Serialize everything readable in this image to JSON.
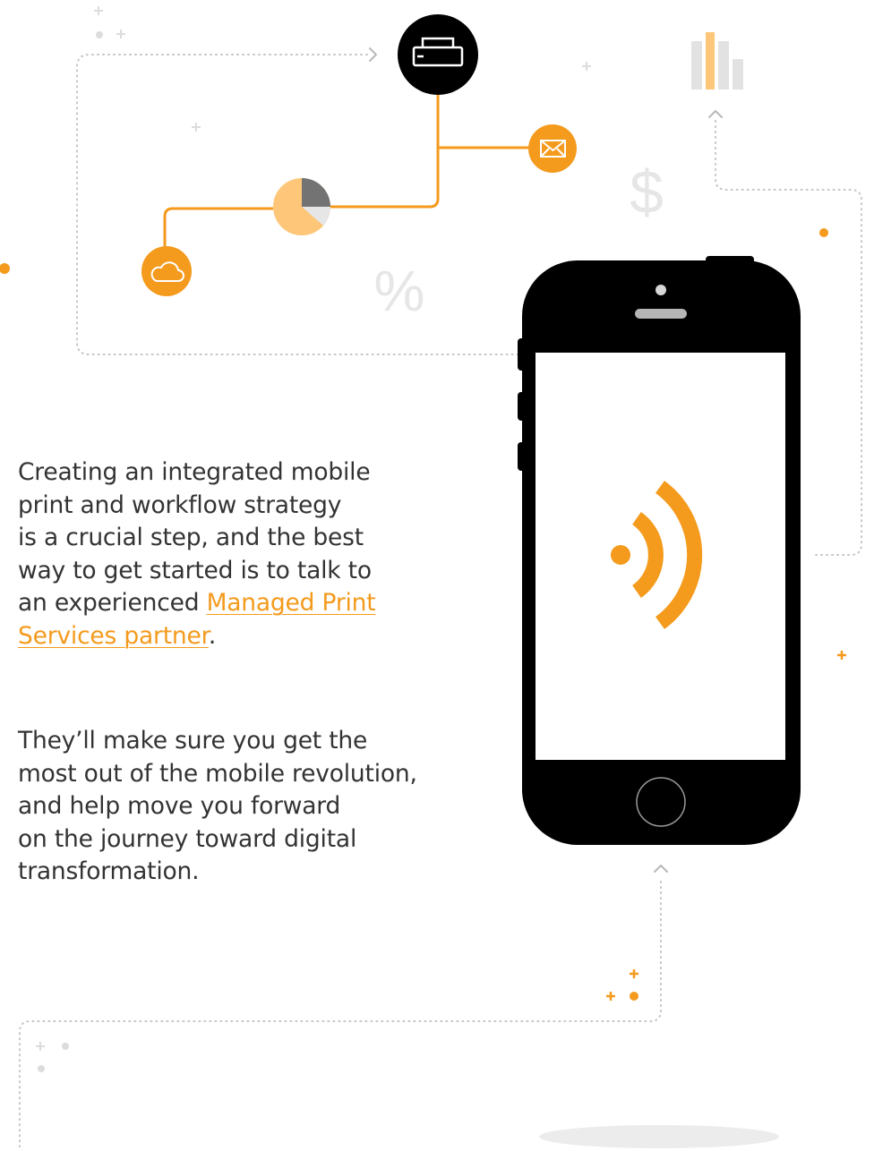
{
  "content": {
    "paragraph1": {
      "lines": [
        "Creating an integrated mobile",
        "print and workflow strategy",
        "is a crucial step, and the best",
        "way to get started is to talk to"
      ],
      "prefix": "an experienced ",
      "link_line1": "Managed Print ",
      "link_line2": "Services partner",
      "suffix": "."
    },
    "paragraph2": {
      "lines": [
        "They’ll make sure you get the",
        "most out of the mobile revolution,",
        "and help move you forward",
        "on the journey toward digital",
        "transformation."
      ]
    }
  },
  "decor": {
    "dollar_symbol": "$",
    "percent_symbol": "%",
    "icons": [
      "printer-icon",
      "envelope-icon",
      "pie-chart-icon",
      "cloud-icon",
      "bar-chart-icon",
      "wifi-signal-icon",
      "home-button"
    ]
  },
  "colors": {
    "accent": "#f49a1c",
    "accent_light": "#fdc678",
    "phone_body": "#000000",
    "text": "#333333",
    "dotted_path": "#c4c4c4",
    "faint_symbol": "#e6e6e6"
  }
}
